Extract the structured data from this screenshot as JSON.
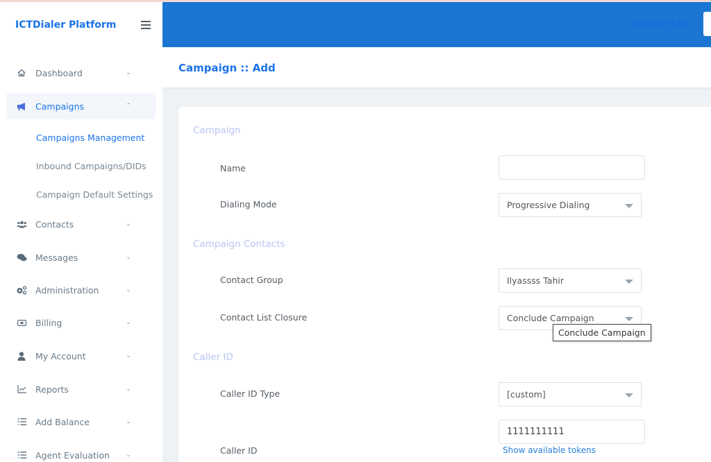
{
  "brand": "ICTDialer Platform",
  "header": {
    "logged_in_label": "Logged in as :",
    "page_title": "Campaign :: Add"
  },
  "colors": {
    "brand": "#1a73e8",
    "topbar": "#1a76d2",
    "section": "#b8c4f5"
  },
  "sidebar": {
    "items": [
      {
        "label": "Dashboard",
        "icon": "home-icon"
      },
      {
        "label": "Campaigns",
        "icon": "megaphone-icon",
        "active": true
      },
      {
        "label": "Contacts",
        "icon": "users-icon"
      },
      {
        "label": "Messages",
        "icon": "comments-icon"
      },
      {
        "label": "Administration",
        "icon": "cogs-icon"
      },
      {
        "label": "Billing",
        "icon": "money-bill-icon"
      },
      {
        "label": "My Account",
        "icon": "user-icon"
      },
      {
        "label": "Reports",
        "icon": "chart-line-icon"
      },
      {
        "label": "Add Balance",
        "icon": "list-check-icon"
      },
      {
        "label": "Agent Evaluation",
        "icon": "list-check-icon"
      }
    ],
    "campaign_sub": [
      {
        "label": "Campaigns Management",
        "active": true
      },
      {
        "label": "Inbound Campaigns/DIDs"
      },
      {
        "label": "Campaign Default Settings"
      }
    ]
  },
  "form": {
    "sections": {
      "campaign": "Campaign",
      "contacts": "Campaign Contacts",
      "caller_id": "Caller ID"
    },
    "name": {
      "label": "Name",
      "value": ""
    },
    "dialing_mode": {
      "label": "Dialing Mode",
      "value": "Progressive Dialing"
    },
    "contact_group": {
      "label": "Contact Group",
      "value": "Ilyassss Tahir"
    },
    "list_closure": {
      "label": "Contact List Closure",
      "value": "Conclude Campaign",
      "tooltip": "Conclude Campaign"
    },
    "caller_id_type": {
      "label": "Caller ID Type",
      "value": "[custom]"
    },
    "caller_id": {
      "label": "Caller ID",
      "value": "1111111111",
      "tokens_link": "Show available tokens"
    }
  }
}
